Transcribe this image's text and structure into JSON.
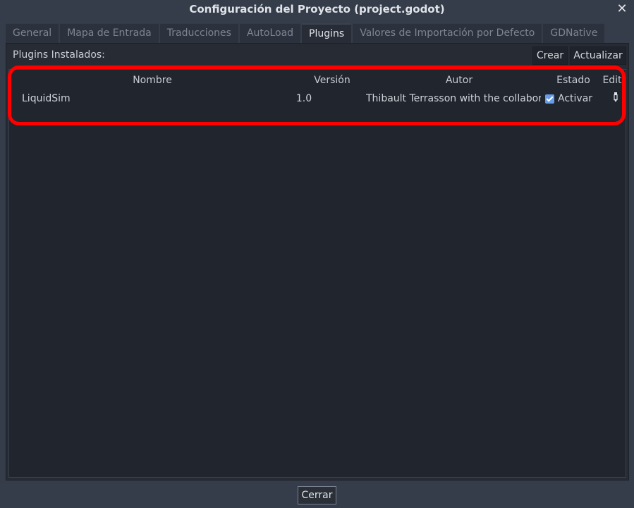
{
  "window": {
    "title": "Configuración del Proyecto (project.godot)",
    "close_glyph": "✕"
  },
  "tabs": [
    {
      "label": "General",
      "active": false
    },
    {
      "label": "Mapa de Entrada",
      "active": false
    },
    {
      "label": "Traducciones",
      "active": false
    },
    {
      "label": "AutoLoad",
      "active": false
    },
    {
      "label": "Plugins",
      "active": true
    },
    {
      "label": "Valores de Importación por Defecto",
      "active": false
    },
    {
      "label": "GDNative",
      "active": false
    }
  ],
  "plugins": {
    "label": "Plugins Instalados:",
    "create_label": "Crear",
    "update_label": "Actualizar",
    "columns": {
      "name": "Nombre",
      "version": "Versión",
      "author": "Autor",
      "state": "Estado",
      "edit": "Edit"
    },
    "rows": [
      {
        "name": "LiquidSim",
        "version": "1.0",
        "author": "Thibault Terrasson with the collabor",
        "state_label": "Activar",
        "enabled": true,
        "edit_icon": "edit-pencil-icon"
      }
    ]
  },
  "footer": {
    "close_label": "Cerrar"
  },
  "colors": {
    "background": "#363d4a",
    "panel": "#262b34",
    "checkbox_accent": "#699ce8",
    "highlight": "#ff0000"
  }
}
